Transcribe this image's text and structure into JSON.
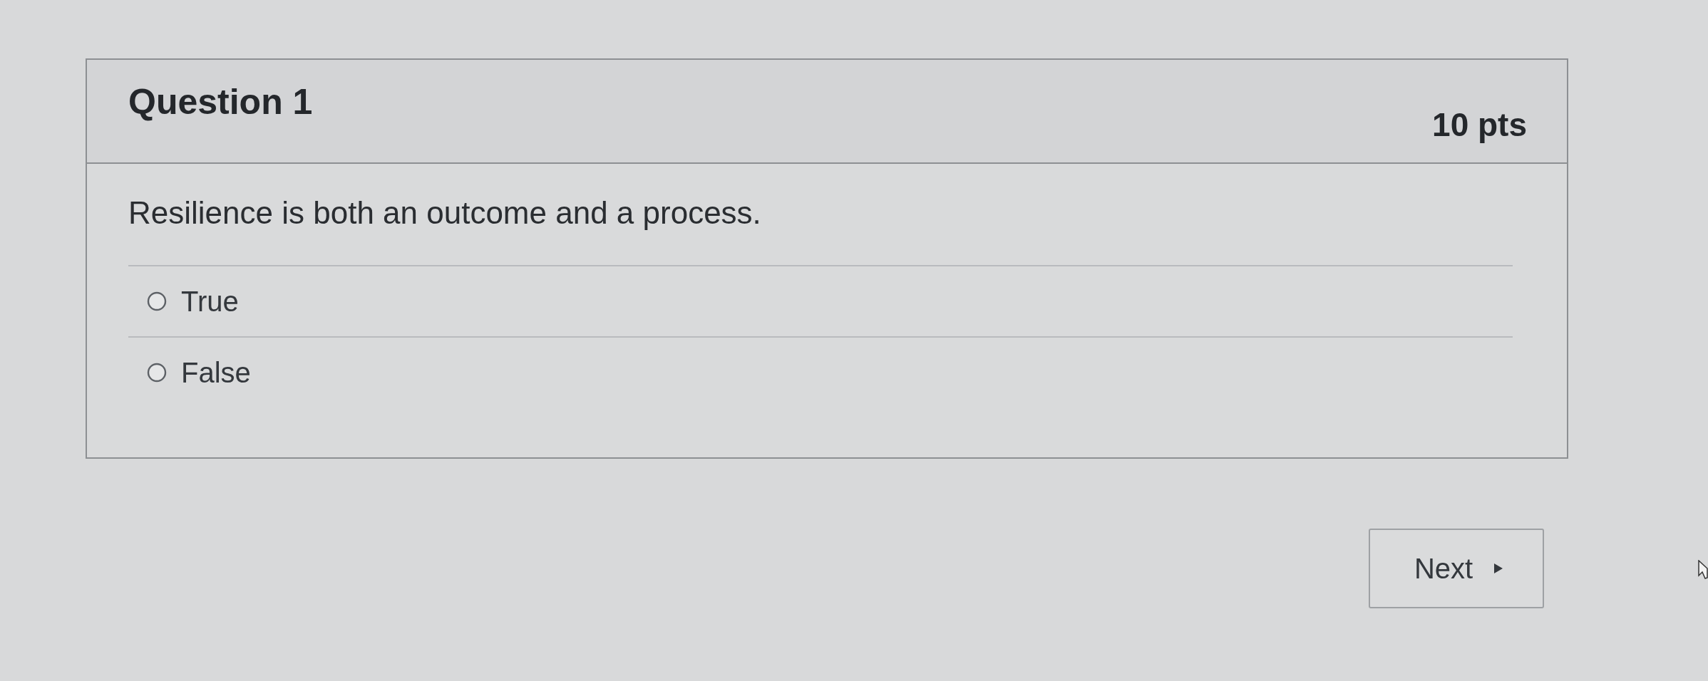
{
  "question": {
    "title": "Question 1",
    "points": "10 pts",
    "text": "Resilience is both an outcome and a process.",
    "answers": [
      {
        "label": "True",
        "selected": false
      },
      {
        "label": "False",
        "selected": false
      }
    ]
  },
  "navigation": {
    "next_button": "Next"
  }
}
